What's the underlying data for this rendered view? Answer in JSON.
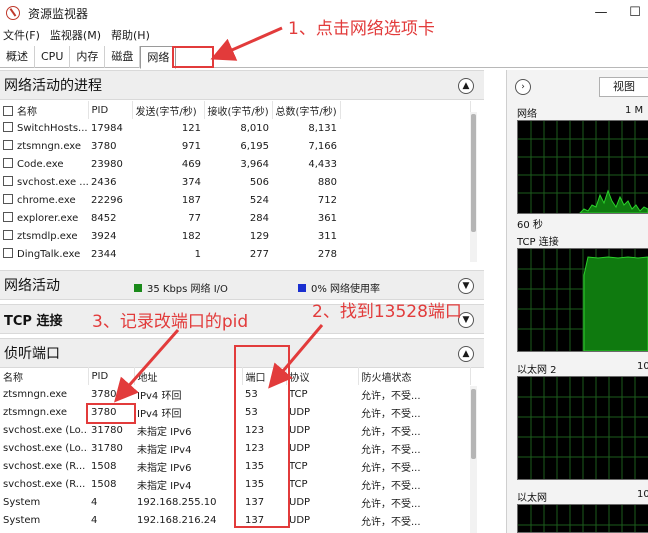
{
  "window": {
    "title": "资源监视器",
    "minimize": "—",
    "maximize": "☐"
  },
  "menu": [
    "文件(F)",
    "监视器(M)",
    "帮助(H)"
  ],
  "tabs": [
    "概述",
    "CPU",
    "内存",
    "磁盘",
    "网络"
  ],
  "processes": {
    "title": "网络活动的进程",
    "columns": [
      "名称",
      "PID",
      "发送(字节/秒)",
      "接收(字节/秒)",
      "总数(字节/秒)"
    ],
    "rows": [
      [
        "SwitchHosts...",
        "17984",
        "121",
        "8,010",
        "8,131"
      ],
      [
        "ztsmngn.exe",
        "3780",
        "971",
        "6,195",
        "7,166"
      ],
      [
        "Code.exe",
        "23980",
        "469",
        "3,964",
        "4,433"
      ],
      [
        "svchost.exe ...",
        "2436",
        "374",
        "506",
        "880"
      ],
      [
        "chrome.exe",
        "22296",
        "187",
        "524",
        "712"
      ],
      [
        "explorer.exe",
        "8452",
        "77",
        "284",
        "361"
      ],
      [
        "ztsmdlp.exe",
        "3924",
        "182",
        "129",
        "311"
      ],
      [
        "DingTalk.exe",
        "2344",
        "1",
        "277",
        "278"
      ]
    ]
  },
  "network_activity": {
    "title": "网络活动",
    "io_label": "35 Kbps 网络 I/O",
    "io_color": "#1a8a1a",
    "usage_label": "0% 网络使用率",
    "usage_color": "#1a2fd0"
  },
  "tcp": {
    "title": "TCP 连接"
  },
  "listening": {
    "title": "侦听端口",
    "columns": [
      "名称",
      "PID",
      "地址",
      "端口",
      "协议",
      "防火墙状态"
    ],
    "rows": [
      [
        "ztsmngn.exe",
        "3780",
        "IPv4 环回",
        "53",
        "TCP",
        "允许，不受..."
      ],
      [
        "ztsmngn.exe",
        "3780",
        "IPv4 环回",
        "53",
        "UDP",
        "允许，不受..."
      ],
      [
        "svchost.exe (Lo...",
        "31780",
        "未指定 IPv6",
        "123",
        "UDP",
        "允许，不受..."
      ],
      [
        "svchost.exe (Lo...",
        "31780",
        "未指定 IPv4",
        "123",
        "UDP",
        "允许，不受..."
      ],
      [
        "svchost.exe (R...",
        "1508",
        "未指定 IPv6",
        "135",
        "TCP",
        "允许，不受..."
      ],
      [
        "svchost.exe (R...",
        "1508",
        "未指定 IPv4",
        "135",
        "TCP",
        "允许，不受..."
      ],
      [
        "System",
        "4",
        "192.168.255.10",
        "137",
        "UDP",
        "允许，不受..."
      ],
      [
        "System",
        "4",
        "192.168.216.24",
        "137",
        "UDP",
        "允许，不受..."
      ]
    ]
  },
  "right_panel": {
    "view_button": "视图",
    "graphs": [
      {
        "label": "网络",
        "value": "1 M"
      },
      {
        "label": "TCP 连接",
        "value": "",
        "sub": "60 秒"
      },
      {
        "label": "以太网 2",
        "value": "10"
      },
      {
        "label": "以太网",
        "value": "10"
      }
    ]
  },
  "annotations": {
    "step1": "1、点击网络选项卡",
    "step2": "2、找到13528端口",
    "step3": "3、记录改端口的pid"
  },
  "accent": "#e23b3b"
}
